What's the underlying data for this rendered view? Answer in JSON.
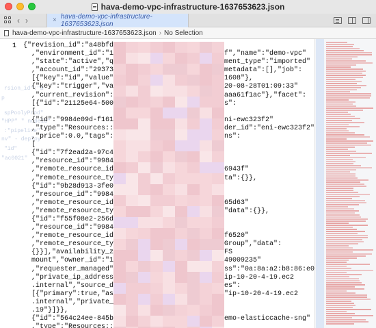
{
  "window": {
    "title": "hava-demo-vpc-infrastructure-1637653623.json",
    "traffic": {
      "close": "#ff5f57",
      "minimize": "#febc2e",
      "zoom": "#28c840"
    }
  },
  "toolbar": {
    "grid_icon": "grid-icon",
    "back_glyph": "‹",
    "forward_glyph": "›"
  },
  "tab": {
    "label": "hava-demo-vpc-infrastructure-1637653623.json",
    "close_glyph": "×",
    "accent": "#d4e4fb"
  },
  "breadcrumb": {
    "file": "hava-demo-vpc-infrastructure-1637653623.json",
    "separator": "›",
    "selection": "No Selection"
  },
  "editor": {
    "line_number": "1",
    "lines": [
      {
        "a": "{\"revision_id\":\"a48bfdac-",
        "b": ""
      },
      {
        "a": "  ,\"environment_id\":\"10",
        "b": "f\",\"name\":\"demo-vpc\""
      },
      {
        "a": "  ,\"state\":\"active\",\"qu",
        "b": "ment_type\":\"imported\""
      },
      {
        "a": "  ,\"account_id\":\"293734",
        "b": "metadata\":[],\"job\":"
      },
      {
        "a": "  [{\"key\":\"id\",\"value\":",
        "b": "1608\"},"
      },
      {
        "a": "  {\"key\":\"trigger\",\"val",
        "b": "20-08-28T01:09:33\""
      },
      {
        "a": "  ,\"current_revision\":{",
        "b": "aaa61f1ac\"},\"facet\":"
      },
      {
        "a": "  [{\"id\":\"21125e64-5006-",
        "b": "s\":"
      },
      {
        "a": "  [",
        "b": ""
      },
      {
        "a": "  {\"id\":\"9984e09d-f161-",
        "b": "ni-ewc323f2\""
      },
      {
        "a": "  ,\"type\":\"Resources::A",
        "b": "der_id\":\"eni-ewc323f2\""
      },
      {
        "a": "  ,\"price\":0.0,\"tags\":[",
        "b": "ns\":"
      },
      {
        "a": "  [",
        "b": ""
      },
      {
        "a": "  {\"id\":\"7f2ead2a-97c4-",
        "b": ""
      },
      {
        "a": "  ,\"resource_id\":\"9984e",
        "b": ""
      },
      {
        "a": "  ,\"remote_resource_id\"",
        "b": "6943f\""
      },
      {
        "a": "  ,\"remote_resource_typ",
        "b": "ta\":{}},"
      },
      {
        "a": "  {\"id\":\"9b28d913-3fe0-",
        "b": ""
      },
      {
        "a": "  ,\"resource_id\":\"9984e",
        "b": ""
      },
      {
        "a": "  ,\"remote_resource_id\"",
        "b": "65d63\""
      },
      {
        "a": "  ,\"remote_resource_typ",
        "b": "\"data\":{}},"
      },
      {
        "a": "  {\"id\":\"f55f08e2-256d-",
        "b": ""
      },
      {
        "a": "  ,\"resource_id\":\"9984e",
        "b": ""
      },
      {
        "a": "  ,\"remote_resource_id\"",
        "b": "f6520\""
      },
      {
        "a": "  ,\"remote_resource_typ",
        "b": "Group\",\"data\":"
      },
      {
        "a": "  {}}],\"availability_zo",
        "b": "FS"
      },
      {
        "a": "  mount\",\"owner_id\":\"12",
        "b": "49009235\""
      },
      {
        "a": "  ,\"requester_managed\":",
        "b": "ss\":\"0a:8a:a2:b8:86:e0\""
      },
      {
        "a": "  ,\"private_ip_address\"",
        "b": "ip-10-20-4-19.ec2"
      },
      {
        "a": "  .internal\",\"source_de",
        "b": "es\":"
      },
      {
        "a": "  [{\"primary\":true,\"ass",
        "b": "\"ip-10-20-4-19.ec2"
      },
      {
        "a": "  .internal\",\"private_i",
        "b": ""
      },
      {
        "a": "  .19\"}]}},",
        "b": ""
      },
      {
        "a": "  {\"id\":\"564c24ee-845b-",
        "b": "emo-elasticcache-sng\""
      },
      {
        "a": "  ,\"type\":\"Resources::A",
        "b": ""
      },
      {
        "a": "  ,\"provider_id\":\"demo-",
        "b": ""
      }
    ]
  },
  "ghost_text": [
    "rsion_id\":\"a",
    "p",
    "spPoolyProd\"",
    "\"HPP\" \" nodeId\"",
    ":\"pipeline\"",
    "nv\" - deploy",
    "\"id\"",
    "\"ac0021\""
  ],
  "colors": {
    "redaction": "#f3cfd4",
    "minimap_mark": "#e6a1a1",
    "tab_text": "#3f5fa8"
  }
}
